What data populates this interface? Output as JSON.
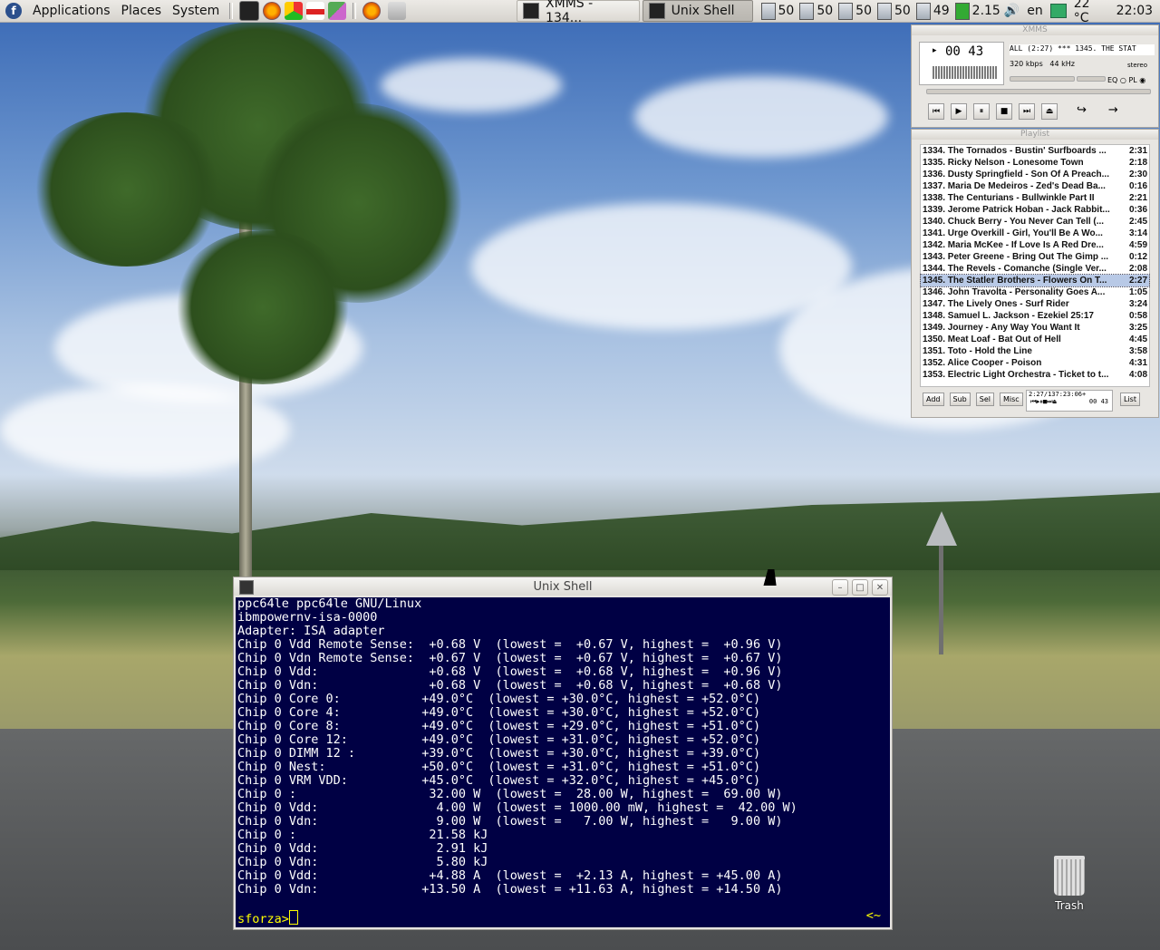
{
  "panel": {
    "menus": [
      "Applications",
      "Places",
      "System"
    ],
    "tasks": [
      {
        "label": "XMMS - 134..."
      },
      {
        "label": "Unix Shell"
      }
    ],
    "monitors": [
      "50",
      "50",
      "50",
      "50",
      "49"
    ],
    "load": "2.15",
    "keyboard": "en",
    "temperature": "22 °C",
    "clock": "22:03"
  },
  "xmms": {
    "title": "XMMS",
    "time": "00 43",
    "song": "ALL (2:27) *** 1345. THE STAT",
    "bitrate": "320 kbps",
    "samplerate": "44 kHz",
    "stereo": "stereo",
    "eq": "EQ",
    "pl": "PL"
  },
  "playlist": {
    "title": "Playlist",
    "items": [
      {
        "name": "1334. The Tornados - Bustin' Surfboards ...",
        "time": "2:31"
      },
      {
        "name": "1335. Ricky Nelson - Lonesome Town",
        "time": "2:18"
      },
      {
        "name": "1336. Dusty Springfield - Son Of A Preach...",
        "time": "2:30"
      },
      {
        "name": "1337. Maria De Medeiros - Zed's Dead Ba...",
        "time": "0:16"
      },
      {
        "name": "1338. The Centurians - Bullwinkle Part II",
        "time": "2:21"
      },
      {
        "name": "1339. Jerome Patrick Hoban - Jack Rabbit...",
        "time": "0:36"
      },
      {
        "name": "1340. Chuck Berry - You Never Can Tell (...",
        "time": "2:45"
      },
      {
        "name": "1341. Urge Overkill - Girl, You'll Be A Wo...",
        "time": "3:14"
      },
      {
        "name": "1342. Maria McKee - If Love Is A Red Dre...",
        "time": "4:59"
      },
      {
        "name": "1343. Peter Greene - Bring Out The Gimp ...",
        "time": "0:12"
      },
      {
        "name": "1344. The Revels - Comanche (Single Ver...",
        "time": "2:08"
      },
      {
        "name": "1345. The Statler Brothers - Flowers On T...",
        "time": "2:27"
      },
      {
        "name": "1346. John Travolta - Personality Goes A...",
        "time": "1:05"
      },
      {
        "name": "1347. The Lively Ones - Surf Rider",
        "time": "3:24"
      },
      {
        "name": "1348. Samuel L. Jackson - Ezekiel 25:17",
        "time": "0:58"
      },
      {
        "name": "1349. Journey - Any Way You Want It",
        "time": "3:25"
      },
      {
        "name": "1350. Meat Loaf - Bat Out of Hell",
        "time": "4:45"
      },
      {
        "name": "1351. Toto - Hold the Line",
        "time": "3:58"
      },
      {
        "name": "1352. Alice Cooper - Poison",
        "time": "4:31"
      },
      {
        "name": "1353. Electric Light Orchestra - Ticket to t...",
        "time": "4:08"
      }
    ],
    "selected_index": 11,
    "buttons": [
      "Add",
      "Sub",
      "Sel",
      "Misc"
    ],
    "status": "2:27/137:23:06+",
    "mini_time": "00 43",
    "list_button": "List"
  },
  "terminal": {
    "title": "Unix Shell",
    "lines": [
      "ppc64le ppc64le GNU/Linux",
      "ibmpowernv-isa-0000",
      "Adapter: ISA adapter",
      "Chip 0 Vdd Remote Sense:  +0.68 V  (lowest =  +0.67 V, highest =  +0.96 V)",
      "Chip 0 Vdn Remote Sense:  +0.67 V  (lowest =  +0.67 V, highest =  +0.67 V)",
      "Chip 0 Vdd:               +0.68 V  (lowest =  +0.68 V, highest =  +0.96 V)",
      "Chip 0 Vdn:               +0.68 V  (lowest =  +0.68 V, highest =  +0.68 V)",
      "Chip 0 Core 0:           +49.0°C  (lowest = +30.0°C, highest = +52.0°C)",
      "Chip 0 Core 4:           +49.0°C  (lowest = +30.0°C, highest = +52.0°C)",
      "Chip 0 Core 8:           +49.0°C  (lowest = +29.0°C, highest = +51.0°C)",
      "Chip 0 Core 12:          +49.0°C  (lowest = +31.0°C, highest = +52.0°C)",
      "Chip 0 DIMM 12 :         +39.0°C  (lowest = +30.0°C, highest = +39.0°C)",
      "Chip 0 Nest:             +50.0°C  (lowest = +31.0°C, highest = +51.0°C)",
      "Chip 0 VRM VDD:          +45.0°C  (lowest = +32.0°C, highest = +45.0°C)",
      "Chip 0 :                  32.00 W  (lowest =  28.00 W, highest =  69.00 W)",
      "Chip 0 Vdd:                4.00 W  (lowest = 1000.00 mW, highest =  42.00 W)",
      "Chip 0 Vdn:                9.00 W  (lowest =   7.00 W, highest =   9.00 W)",
      "Chip 0 :                  21.58 kJ",
      "Chip 0 Vdd:                2.91 kJ",
      "Chip 0 Vdn:                5.80 kJ",
      "Chip 0 Vdd:               +4.88 A  (lowest =  +2.13 A, highest = +45.00 A)",
      "Chip 0 Vdn:              +13.50 A  (lowest = +11.63 A, highest = +14.50 A)"
    ],
    "prompt": "sforza>",
    "right_prompt": "<~"
  },
  "desktop": {
    "trash_label": "Trash"
  }
}
